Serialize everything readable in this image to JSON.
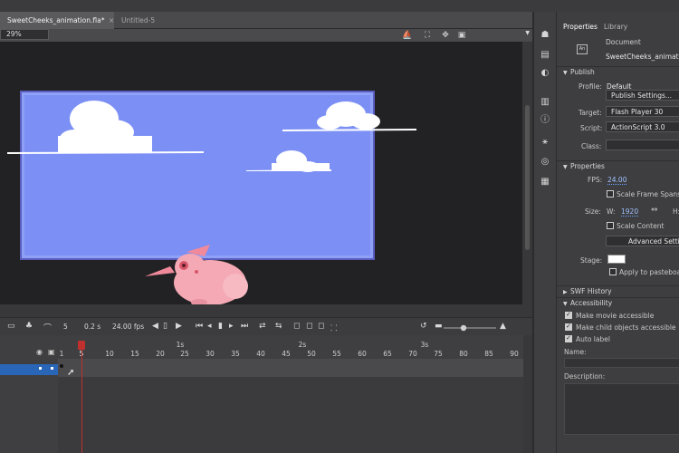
{
  "tabs": [
    {
      "label": "SweetCheeks_animation.fla*",
      "close": "×"
    },
    {
      "label": "Untitled-5"
    }
  ],
  "stage_toolbar": {
    "zoom": "29%"
  },
  "timeline": {
    "frame": "5",
    "time": "0.2 s",
    "fps": "24.00 fps",
    "ruler_numbers": [
      "1",
      "5",
      "10",
      "15",
      "20",
      "25",
      "30",
      "35",
      "40",
      "45",
      "50",
      "55",
      "60",
      "65",
      "70",
      "75",
      "80",
      "85",
      "90"
    ],
    "ruler_seconds": [
      "1s",
      "2s",
      "3s"
    ]
  },
  "properties": {
    "tabs": [
      "Properties",
      "Library"
    ],
    "doc_type": "Document",
    "doc_name": "SweetCheeks_animati",
    "publish": {
      "header": "Publish",
      "profile_label": "Profile:",
      "profile_value": "Default",
      "settings_btn": "Publish Settings...",
      "target_label": "Target:",
      "target_value": "Flash Player 30",
      "script_label": "Script:",
      "script_value": "ActionScript 3.0",
      "class_label": "Class:"
    },
    "props": {
      "header": "Properties",
      "fps_label": "FPS:",
      "fps_value": "24.00",
      "scale_frame_spans": "Scale Frame Spans",
      "size_label": "Size:",
      "w_label": "W:",
      "w_value": "1920",
      "h_label": "H:",
      "scale_content": "Scale Content",
      "advanced_btn": "Advanced Setti",
      "stage_label": "Stage:",
      "apply_pasteboard": "Apply to pasteboa"
    },
    "swf_history": "SWF History",
    "accessibility": {
      "header": "Accessibility",
      "make_movie": "Make movie accessible",
      "make_child": "Make child objects accessible",
      "auto_label": "Auto label",
      "name_label": "Name:",
      "desc_label": "Description:"
    }
  },
  "colors": {
    "canvas": "#7b8ff5",
    "pasteboard": "#222124",
    "pig": "#f4a9b4",
    "playhead": "#c0302f"
  }
}
